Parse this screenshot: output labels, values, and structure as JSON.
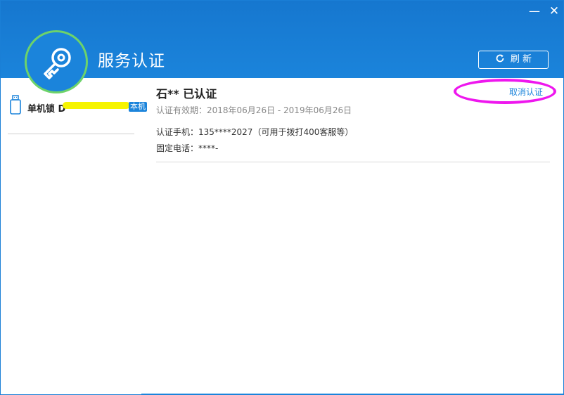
{
  "window": {
    "title": "服务认证",
    "minimize_label": "—",
    "close_label": "✕",
    "refresh_label": "刷 新",
    "refresh_icon": "refresh-icon",
    "logo_icon": "key-icon"
  },
  "colors": {
    "header_blue": "#1b84db",
    "logo_ring_green": "#6dd36a",
    "highlight_magenta": "#ee17ee",
    "redaction_yellow": "#f6f400"
  },
  "sidebar": {
    "items": [
      {
        "icon": "usb-key-icon",
        "label": "单机锁 D",
        "tag": "本机"
      }
    ]
  },
  "cert": {
    "name_line": "石** 已认证",
    "cancel_label": "取消认证",
    "validity": "认证有效期：2018年06月26日 - 2019年06月26日",
    "phone": "认证手机：135****2027（可用于拨打400客服等）",
    "landline": "固定电话：****-"
  }
}
